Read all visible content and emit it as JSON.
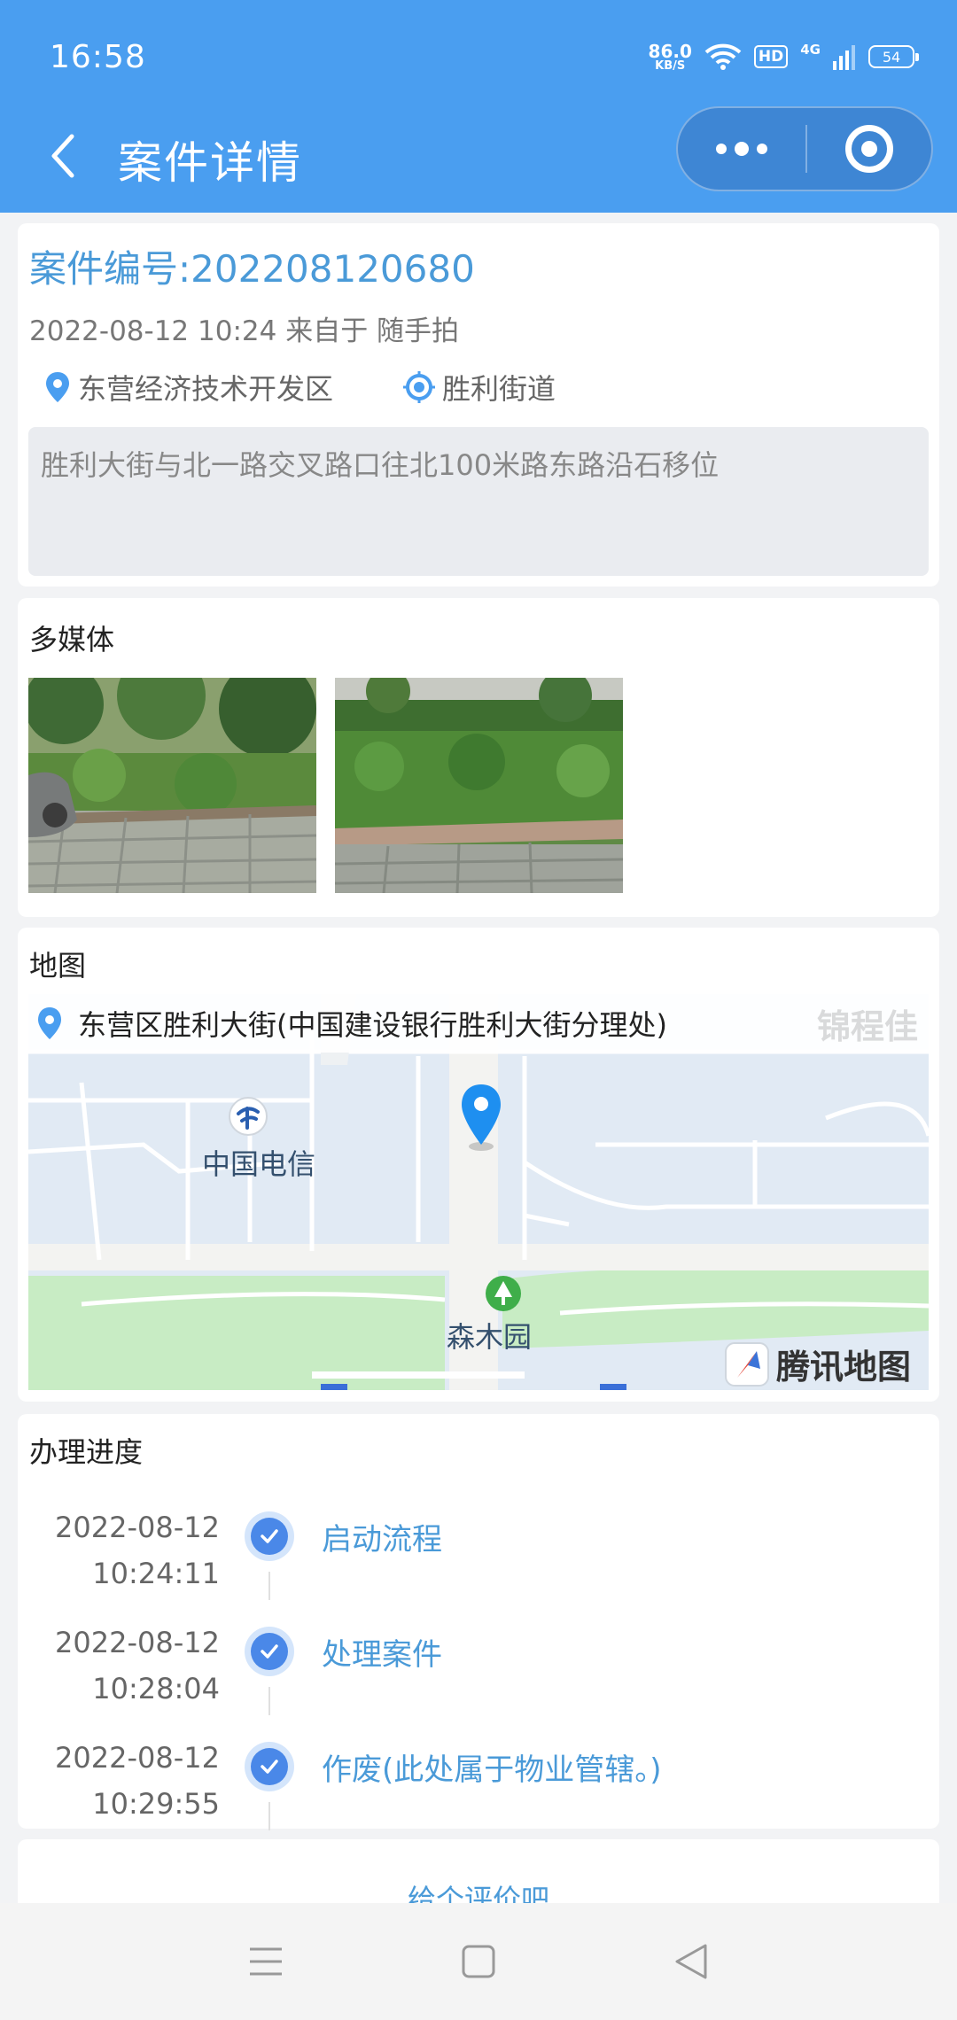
{
  "status_bar": {
    "time": "16:58",
    "net_speed_value": "86.0",
    "net_speed_unit": "KB/S",
    "hd_label": "HD",
    "signal_label": "4G",
    "battery": "54"
  },
  "nav": {
    "title": "案件详情",
    "back_icon": "chevron-left-icon",
    "more_icon": "more-dots-icon",
    "close_icon": "target-close-icon"
  },
  "case": {
    "number_label": "案件编号:202208120680",
    "meta": "2022-08-12 10:24 来自于 随手拍",
    "district": "东营经济技术开发区",
    "street": "胜利街道",
    "description": "胜利大街与北一路交叉路口往北100米路东路沿石移位"
  },
  "media": {
    "title": "多媒体"
  },
  "map": {
    "title": "地图",
    "address": "东营区胜利大街(中国建设银行胜利大街分理处)",
    "poi_telecom": "中国电信",
    "poi_park": "森木园",
    "poi_faded": "锦程佳",
    "logo_text": "腾讯地图"
  },
  "progress": {
    "title": "办理进度",
    "steps": [
      {
        "date": "2022-08-12",
        "time": "10:24:11",
        "label": "启动流程"
      },
      {
        "date": "2022-08-12",
        "time": "10:28:04",
        "label": "处理案件"
      },
      {
        "date": "2022-08-12",
        "time": "10:29:55",
        "label": "作废(此处属于物业管辖。)"
      }
    ]
  },
  "rating": {
    "link_text": "给个评价吧"
  },
  "colors": {
    "primary": "#4a9ef0",
    "link": "#4a9ad8",
    "timeline_dot": "#4a88e8"
  }
}
